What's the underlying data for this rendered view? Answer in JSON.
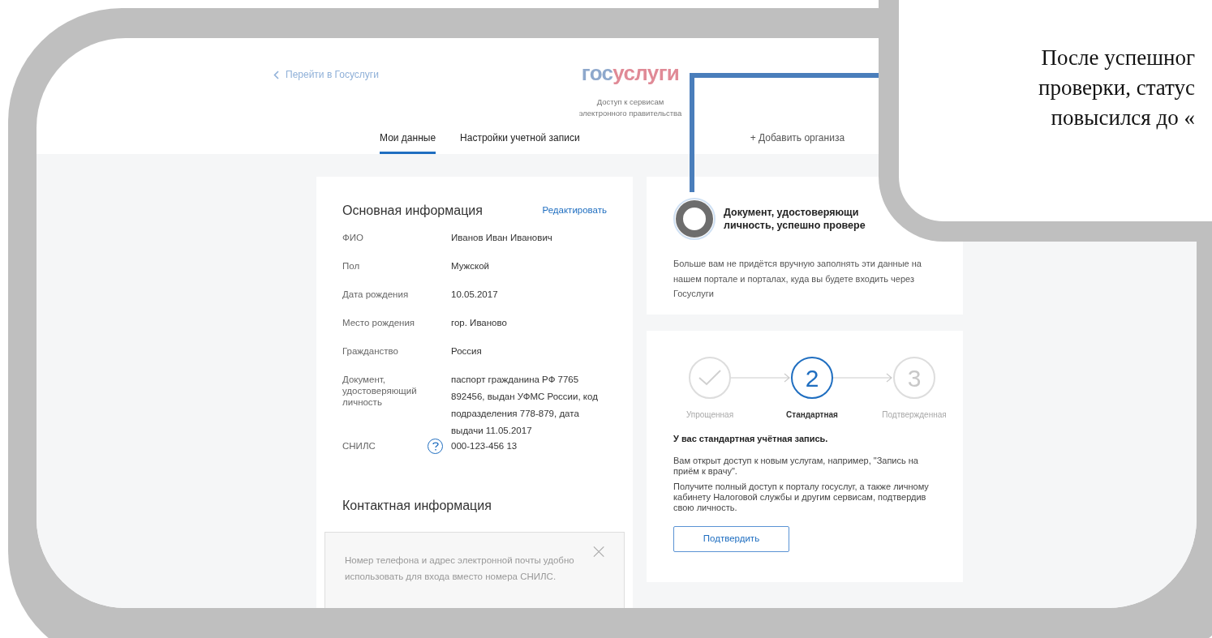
{
  "header": {
    "back_link": "Перейти в Госуслуги",
    "logo": [
      "гос",
      "услуги"
    ],
    "subtitle": [
      "Доступ к сервисам",
      "электронного правительства"
    ]
  },
  "tabs": [
    {
      "label": "Мои данные",
      "selected": true
    },
    {
      "label": "Настройки учетной записи",
      "selected": false
    }
  ],
  "add_org_link": "+ Добавить организа",
  "basic_info": {
    "title": "Основная информация",
    "edit_link": "Редактировать",
    "rows": [
      {
        "label": "ФИО",
        "value": "Иванов Иван Иванович",
        "help": false
      },
      {
        "label": "Пол",
        "value": "Мужской",
        "help": false
      },
      {
        "label": "Дата рождения",
        "value": "10.05.2017",
        "help": false
      },
      {
        "label": "Место рождения",
        "value": "гор. Иваново",
        "help": false
      },
      {
        "label": "Гражданство",
        "value": "Россия",
        "help": false
      },
      {
        "label": "Документ, удостоверяющий личность",
        "value": "паспорт гражданина РФ 7765 892456, выдан УФМС России, код подразделения 778-879, дата выдачи 11.05.2017",
        "help": false
      },
      {
        "label": "СНИЛС",
        "value": "000-123-456 13",
        "help": true
      }
    ]
  },
  "contact_info": {
    "title": "Контактная информация",
    "notice": "Номер телефона и адрес электронной почты удобно использовать для входа вместо номера СНИЛС."
  },
  "verification_card": {
    "title_lines": [
      "Документ, удостоверяющи",
      "личность, успешно провере"
    ],
    "body": "Больше вам не придётся вручную заполнять эти данные на нашем портале и порталах, куда вы будете входить через Госуслуги"
  },
  "status_card": {
    "steps": [
      {
        "kind": "done",
        "label": "Упрощенная"
      },
      {
        "kind": "current",
        "number": "2",
        "label": "Стандартная"
      },
      {
        "kind": "todo",
        "number": "3",
        "label": "Подтвержденная"
      }
    ],
    "heading": "У вас стандартная учётная запись.",
    "paragraphs": [
      "Вам открыт доступ к новым услугам, например, \"Запись на приём к врачу\".",
      "Получите полный доступ к порталу госуслуг, а также личному кабинету Налоговой службы и другим сервисам, подтвердив свою личность."
    ],
    "button": "Подтвердить"
  },
  "callout": {
    "lines": [
      "После успешног",
      "проверки, статус",
      "повысился до «"
    ]
  }
}
